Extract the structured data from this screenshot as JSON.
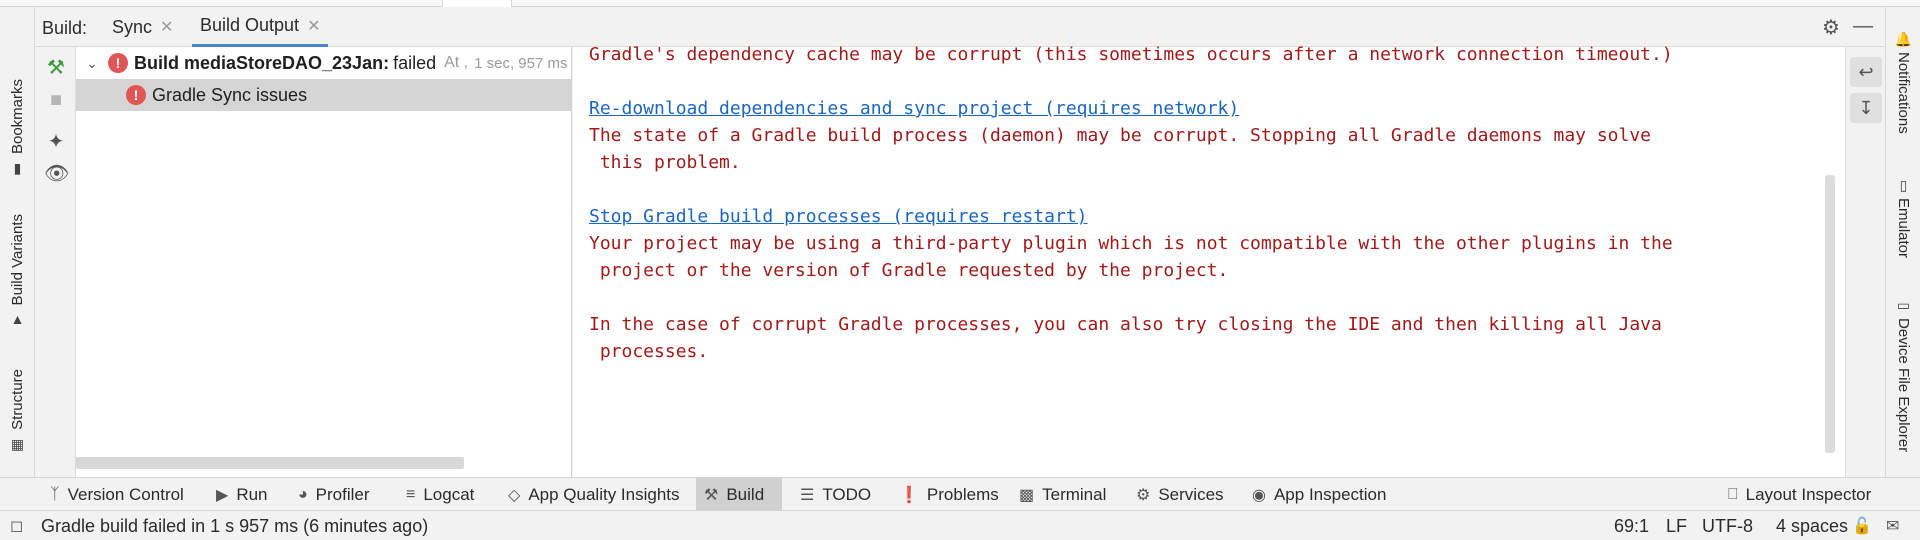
{
  "header": {
    "title": "Build:",
    "tabs": [
      {
        "label": "Sync"
      },
      {
        "label": "Build Output"
      }
    ]
  },
  "left_stripe": {
    "tabs": [
      {
        "label": "Bookmarks",
        "icon": "bookmark-icon"
      },
      {
        "label": "Build Variants",
        "icon": "android-icon"
      },
      {
        "label": "Structure",
        "icon": "structure-icon"
      }
    ]
  },
  "right_stripe": {
    "tabs": [
      {
        "label": "Notifications",
        "icon": "bell-icon"
      },
      {
        "label": "Emulator",
        "icon": "phone-icon"
      },
      {
        "label": "Device File Explorer",
        "icon": "device-icon"
      }
    ]
  },
  "tree": {
    "root": {
      "name": "Build mediaStoreDAO_23Jan:",
      "status": "failed",
      "at": "At ,",
      "duration": "1 sec, 957 ms"
    },
    "child": {
      "label": "Gradle Sync issues"
    }
  },
  "console": {
    "lines": [
      {
        "text": "Gradle's dependency cache may be corrupt (this sometimes occurs after a network connection timeout.)",
        "link": false
      },
      {
        "text": "",
        "link": false
      },
      {
        "text": "Re-download dependencies and sync project (requires network)",
        "link": true
      },
      {
        "text": "The state of a Gradle build process (daemon) may be corrupt. Stopping all Gradle daemons may solve",
        "link": false
      },
      {
        "text": " this problem.",
        "link": false
      },
      {
        "text": "",
        "link": false
      },
      {
        "text": "Stop Gradle build processes (requires restart)",
        "link": true
      },
      {
        "text": "Your project may be using a third-party plugin which is not compatible with the other plugins in the",
        "link": false
      },
      {
        "text": " project or the version of Gradle requested by the project.",
        "link": false
      },
      {
        "text": "",
        "link": false
      },
      {
        "text": "In the case of corrupt Gradle processes, you can also try closing the IDE and then killing all Java",
        "link": false
      },
      {
        "text": " processes.",
        "link": false
      }
    ]
  },
  "bottom_bar": {
    "items": [
      {
        "label": "Version Control",
        "icon": "version-control-icon"
      },
      {
        "label": "Run",
        "icon": "play-icon"
      },
      {
        "label": "Profiler",
        "icon": "gauge-icon"
      },
      {
        "label": "Logcat",
        "icon": "logcat-icon"
      },
      {
        "label": "App Quality Insights",
        "icon": "diamond-icon"
      },
      {
        "label": "Build",
        "icon": "hammer-icon"
      },
      {
        "label": "TODO",
        "icon": "list-icon"
      },
      {
        "label": "Problems",
        "icon": "warning-icon"
      },
      {
        "label": "Terminal",
        "icon": "terminal-icon"
      },
      {
        "label": "Services",
        "icon": "services-icon"
      },
      {
        "label": "App Inspection",
        "icon": "inspection-icon"
      },
      {
        "label": "Layout Inspector",
        "icon": "layout-inspector-icon"
      }
    ],
    "active": "Build"
  },
  "status_bar": {
    "message": "Gradle build failed in 1 s 957 ms (6 minutes ago)",
    "position": "69:1",
    "line_ending": "LF",
    "encoding": "UTF-8",
    "indent": "4 spaces"
  },
  "colors": {
    "error_text": "#a11a1a",
    "link": "#1a66c2",
    "error_badge": "#e05555",
    "active_tab_underline": "#4a83c8"
  }
}
